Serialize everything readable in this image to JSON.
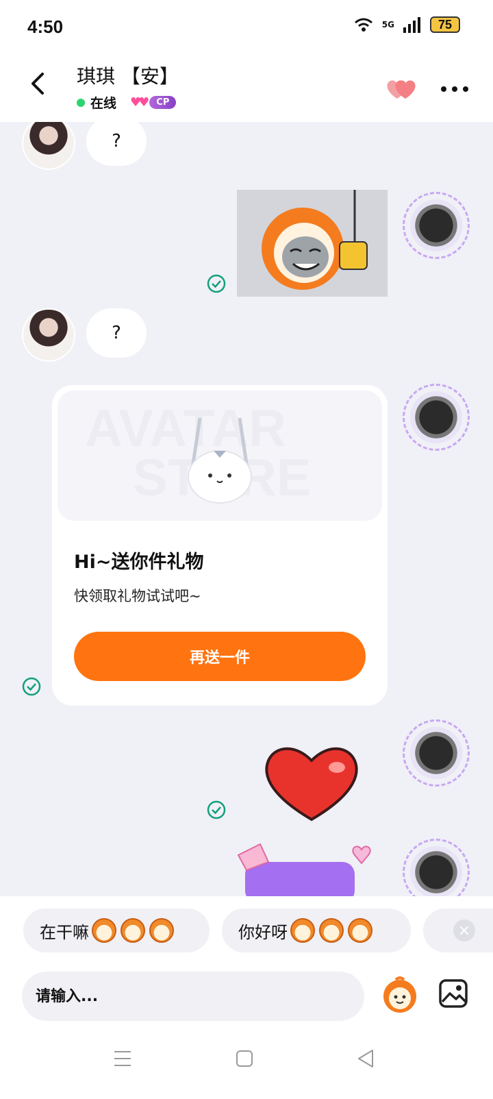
{
  "status_bar": {
    "time": "4:50",
    "network": "5G",
    "battery": "75"
  },
  "header": {
    "peer_name": "琪琪 【安】",
    "online_label": "在线",
    "badge_label": "CP"
  },
  "messages": {
    "received_1": "?",
    "received_2": "?"
  },
  "gift_card": {
    "watermark_line1": "AVATAR",
    "watermark_line2": "STORE",
    "title": "Hi~送你件礼物",
    "subtitle": "快领取礼物试试吧~",
    "button_label": "再送一件"
  },
  "quick_replies": [
    {
      "text": "在干嘛"
    },
    {
      "text": "你好呀"
    }
  ],
  "input": {
    "placeholder": "请输入..."
  },
  "colors": {
    "accent": "#ff7410",
    "online": "#2bd46e",
    "read_check": "#11a07a"
  }
}
